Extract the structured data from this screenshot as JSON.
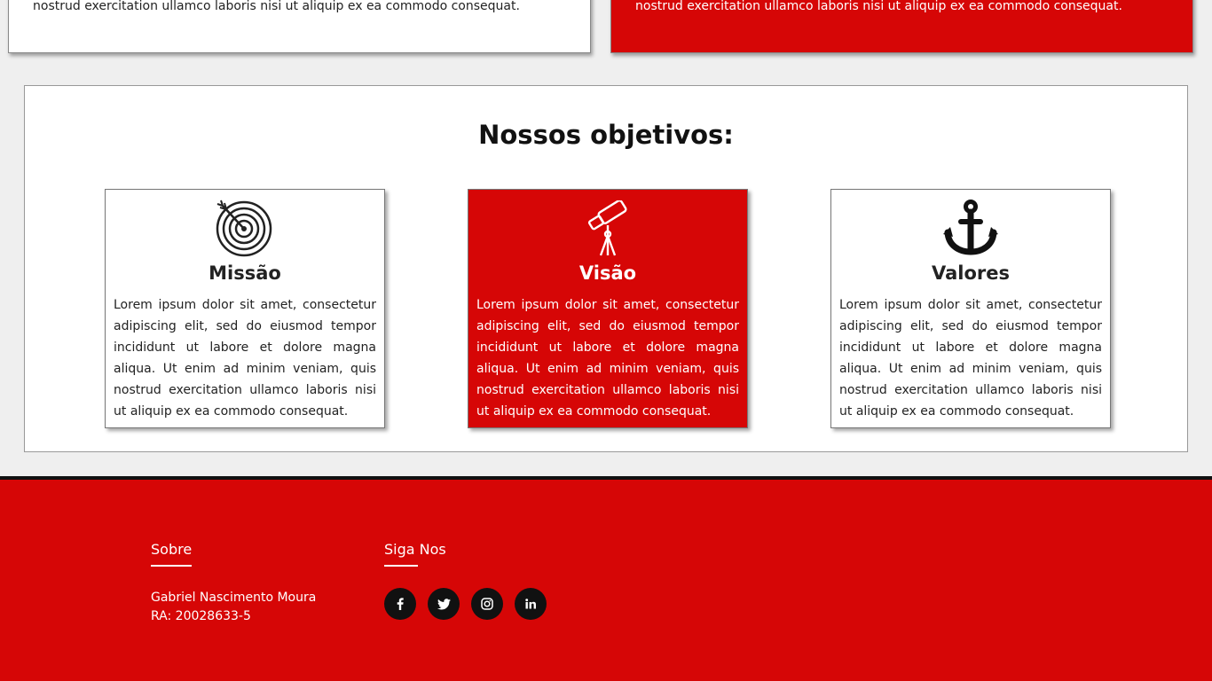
{
  "top_cards": {
    "left_text": "nostrud exercitation ullamco laboris nisi ut aliquip ex ea commodo consequat.",
    "right_text": "nostrud exercitation ullamco laboris nisi ut aliquip ex ea commodo consequat."
  },
  "objectives": {
    "title": "Nossos objetivos:",
    "cards": [
      {
        "icon": "target-icon",
        "title": "Missão",
        "text": "Lorem ipsum dolor sit amet, consectetur adipiscing elit, sed do eiusmod tempor incididunt ut labore et dolore magna aliqua. Ut enim ad minim veniam, quis nostrud exercitation ullamco laboris nisi ut aliquip ex ea commodo consequat."
      },
      {
        "icon": "telescope-icon",
        "title": "Visão",
        "text": "Lorem ipsum dolor sit amet, consectetur adipiscing elit, sed do eiusmod tempor incididunt ut labore et dolore magna aliqua. Ut enim ad minim veniam, quis nostrud exercitation ullamco laboris nisi ut aliquip ex ea commodo consequat."
      },
      {
        "icon": "anchor-icon",
        "title": "Valores",
        "text": "Lorem ipsum dolor sit amet, consectetur adipiscing elit, sed do eiusmod tempor incididunt ut labore et dolore magna aliqua. Ut enim ad minim veniam, quis nostrud exercitation ullamco laboris nisi ut aliquip ex ea commodo consequat."
      }
    ]
  },
  "footer": {
    "about_title": "Sobre",
    "about_name": "Gabriel Nascimento Moura",
    "about_ra": "RA: 20028633-5",
    "social_title": "Siga Nos",
    "social_icons": [
      "facebook-icon",
      "twitter-icon",
      "instagram-icon",
      "linkedin-icon"
    ]
  },
  "colors": {
    "accent_red": "#d60606",
    "footer_border": "#111111",
    "social_button": "#111111"
  }
}
